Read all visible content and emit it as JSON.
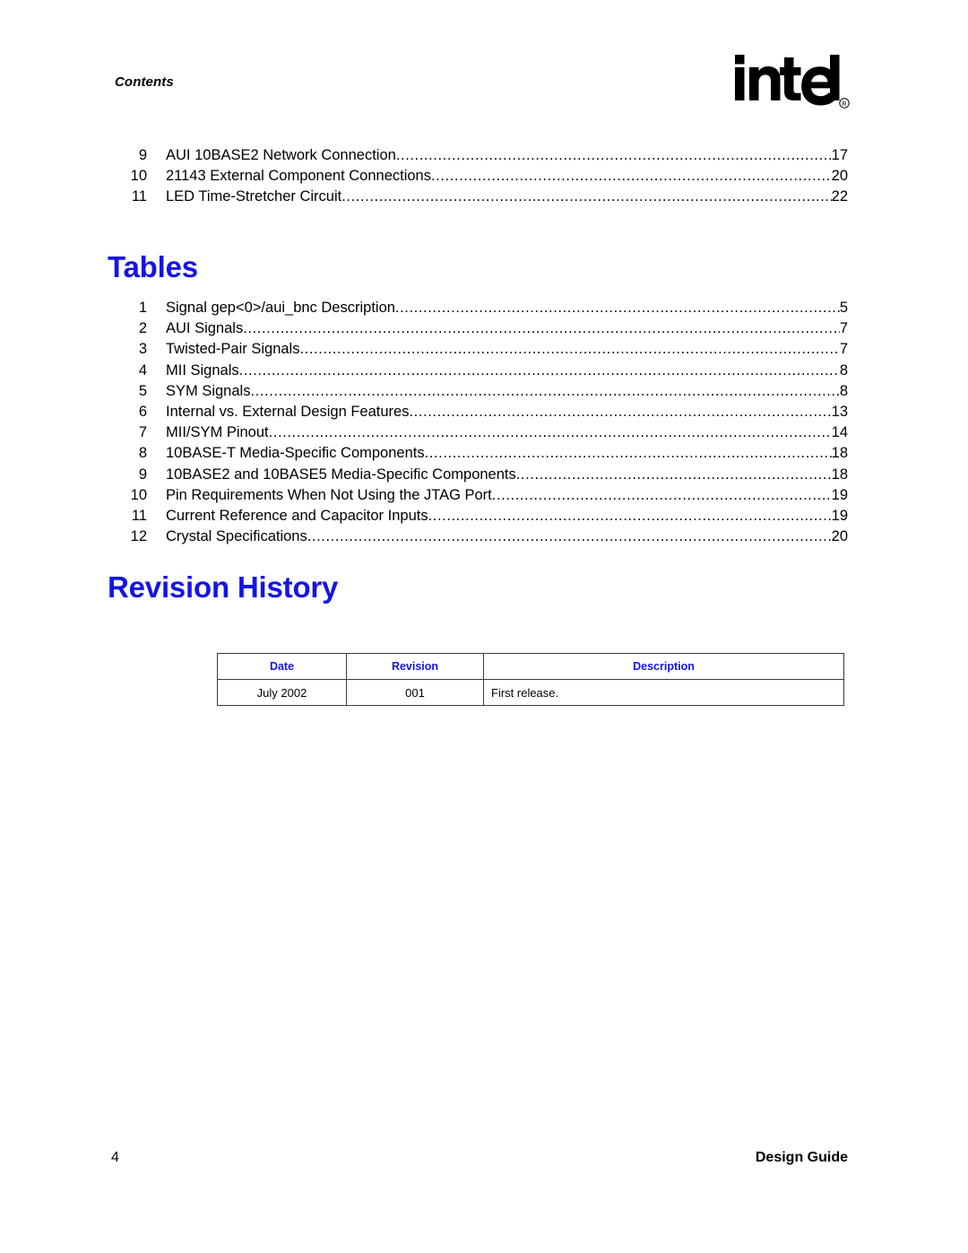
{
  "header": {
    "running_head": "Contents",
    "logo_alt": "intel",
    "logo_trademark": "®"
  },
  "figures": {
    "entries": [
      {
        "num": "9",
        "title": "AUI 10BASE2 Network Connection",
        "page": "17"
      },
      {
        "num": "10",
        "title": "21143 External Component Connections",
        "page": "20"
      },
      {
        "num": "11",
        "title": "LED Time-Stretcher Circuit",
        "page": "22"
      }
    ]
  },
  "tables_section": {
    "heading": "Tables",
    "entries": [
      {
        "num": "1",
        "title": "Signal gep<0>/aui_bnc Description",
        "page": "5"
      },
      {
        "num": "2",
        "title": "AUI Signals",
        "page": "7"
      },
      {
        "num": "3",
        "title": "Twisted-Pair Signals",
        "page": "7"
      },
      {
        "num": "4",
        "title": "MII Signals",
        "page": "8"
      },
      {
        "num": "5",
        "title": "SYM Signals",
        "page": "8"
      },
      {
        "num": "6",
        "title": " Internal vs. External Design Features ",
        "page": "13"
      },
      {
        "num": "7",
        "title": "MII/SYM Pinout",
        "page": "14"
      },
      {
        "num": "8",
        "title": "10BASE-T Media-Specific Components",
        "page": "18"
      },
      {
        "num": "9",
        "title": "10BASE2 and 10BASE5 Media-Specific Components ",
        "page": "18"
      },
      {
        "num": "10",
        "title": "Pin Requirements When Not Using the JTAG Port",
        "page": "19"
      },
      {
        "num": "11",
        "title": "Current Reference and Capacitor Inputs",
        "page": "19"
      },
      {
        "num": "12",
        "title": "Crystal Specifications ",
        "page": "20"
      }
    ]
  },
  "revision_history": {
    "heading": "Revision History",
    "columns": [
      "Date",
      "Revision",
      "Description"
    ],
    "rows": [
      {
        "date": "July 2002",
        "revision": "001",
        "description": "First release."
      }
    ]
  },
  "footer": {
    "page_number": "4",
    "document_title": "Design Guide"
  },
  "colors": {
    "heading_blue": "#1414E6",
    "text_black": "#000000",
    "page_background": "#FFFFFF",
    "table_border": "#3B3B3B"
  }
}
